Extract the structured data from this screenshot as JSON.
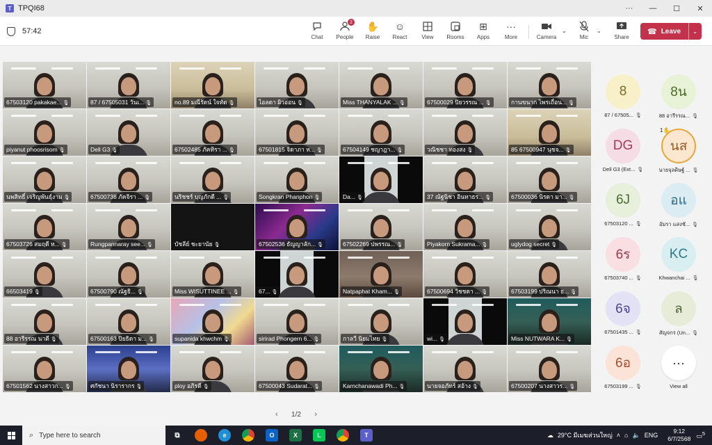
{
  "window": {
    "title": "TPQI68",
    "app_icon": "teams-icon",
    "controls": {
      "more": "···",
      "minimize": "—",
      "maximize": "☐",
      "close": "✕"
    }
  },
  "toolbar": {
    "timer": "57:42",
    "chat": "Chat",
    "people": "People",
    "people_badge": "2",
    "raise": "Raise",
    "react": "React",
    "view": "View",
    "rooms": "Rooms",
    "apps": "Apps",
    "more": "More",
    "camera": "Camera",
    "mic": "Mic",
    "share": "Share",
    "leave": "Leave"
  },
  "tiles": [
    {
      "name": "67503120 pakakae..."
    },
    {
      "name": "87 / 67505031 วันเ..."
    },
    {
      "name": "no.89 มณีรัตน์ ใจทัด"
    },
    {
      "name": "ไอลดา ผิวอ่อน"
    },
    {
      "name": "Miss THANYALAK ..."
    },
    {
      "name": "67500029 ปิยวรรณ ..."
    },
    {
      "name": "กานขนาก ไพรเถื่อน..."
    },
    {
      "name": "piyanut phoosrisom"
    },
    {
      "name": "Dell G3"
    },
    {
      "name": "67502485 ภัคทิรา ..."
    },
    {
      "name": "67501815 จิดาภา ห..."
    },
    {
      "name": "67504149 ชญาฎา..."
    },
    {
      "name": "วณิชชา ทองสง"
    },
    {
      "name": "85 67500947 นุชจ..."
    },
    {
      "name": "นพสิทธิ์ เจริญพันธุ์งาม"
    },
    {
      "name": "67500738 ภัคจิรา ..."
    },
    {
      "name": "นริชชร์ บุญภักดี ..."
    },
    {
      "name": "Songkran Phanphon"
    },
    {
      "name": "Da..."
    },
    {
      "name": "37 ณัฐนิชา อินทาธร..."
    },
    {
      "name": "67500036 นิรดา มา..."
    },
    {
      "name": "67503726 สมฤดี ห..."
    },
    {
      "name": "Rungpannaray see..."
    },
    {
      "name": "บัชลีย์ ชะยานัย"
    },
    {
      "name": "67502536 ธัญญาลัก..."
    },
    {
      "name": "67502269 ปพรรณ..."
    },
    {
      "name": "Piyakorn Sukrama..."
    },
    {
      "name": "uglydog secret"
    },
    {
      "name": "66503419"
    },
    {
      "name": "67500790 ณัฐธิ..."
    },
    {
      "name": "Miss WISUTTINEE ..."
    },
    {
      "name": "67..."
    },
    {
      "name": "Natpaphat Kham..."
    },
    {
      "name": "67500694 วิชชดา ..."
    },
    {
      "name": "67503199 ปริณนา ธ..."
    },
    {
      "name": "88 อารีรรณ นาดี"
    },
    {
      "name": "67500163 ปิยธิดา ม..."
    },
    {
      "name": "supanida khwchm"
    },
    {
      "name": "sirirad Phongern 6..."
    },
    {
      "name": "กาลวี นิยมไทย"
    },
    {
      "name": "wi..."
    },
    {
      "name": "Miss NUTWARA K..."
    },
    {
      "name": "67501562 นางสาวก..."
    },
    {
      "name": "ศกัชนา นิรารากร"
    },
    {
      "name": "ploy อภิรดี"
    },
    {
      "name": "67500043 Sudarat..."
    },
    {
      "name": "Karnchanawadi Ph..."
    },
    {
      "name": "นายจอภัทร์ สอ้าง"
    },
    {
      "name": "67500207 นางสาวร..."
    }
  ],
  "pager": {
    "label": "1/2",
    "prev": "‹",
    "next": "›"
  },
  "participants": [
    {
      "initials": "8",
      "label": "87 / 67505...",
      "bg": "#f7f0c8",
      "fg": "#7a6a2a"
    },
    {
      "initials": "8น",
      "label": "88 อารีรรณ...",
      "bg": "#e8f2d6",
      "fg": "#4a6a2a"
    },
    {
      "initials": "DG",
      "label": "Dell G3 (Ext...",
      "bg": "#f6dce5",
      "fg": "#a33a5d"
    },
    {
      "initials": "นส",
      "label": "นายจุลดิษฐ์ ...",
      "bg": "#fbe6cf",
      "fg": "#a0571b",
      "raise": "1✋"
    },
    {
      "initials": "6J",
      "label": "67503120 ...",
      "bg": "#e6f0da",
      "fg": "#4c6b30"
    },
    {
      "initials": "อแ",
      "label": "อัมรา แสงชั...",
      "bg": "#dcecf3",
      "fg": "#2b6a86"
    },
    {
      "initials": "6ร",
      "label": "67503740 ...",
      "bg": "#f9dee2",
      "fg": "#a0394b"
    },
    {
      "initials": "KC",
      "label": "Khwanchai ...",
      "bg": "#d9eef1",
      "fg": "#2e7a87"
    },
    {
      "initials": "6จ",
      "label": "67501435 ...",
      "bg": "#e3e1f4",
      "fg": "#4b4596"
    },
    {
      "initials": "ล",
      "label": "สัญจกร (Un...",
      "bg": "#e7ecd9",
      "fg": "#4f6534"
    },
    {
      "initials": "6อ",
      "label": "67503199 ...",
      "bg": "#fbe3d8",
      "fg": "#a84e2c"
    },
    {
      "initials": "···",
      "label": "View all",
      "more": true
    }
  ],
  "taskbar": {
    "search_placeholder": "Type here to search",
    "weather": "29°C มีเมฆส่วนใหญ่",
    "lang": "ENG",
    "time": "9:12",
    "date": "6/7/2568",
    "notif_count": "5"
  }
}
